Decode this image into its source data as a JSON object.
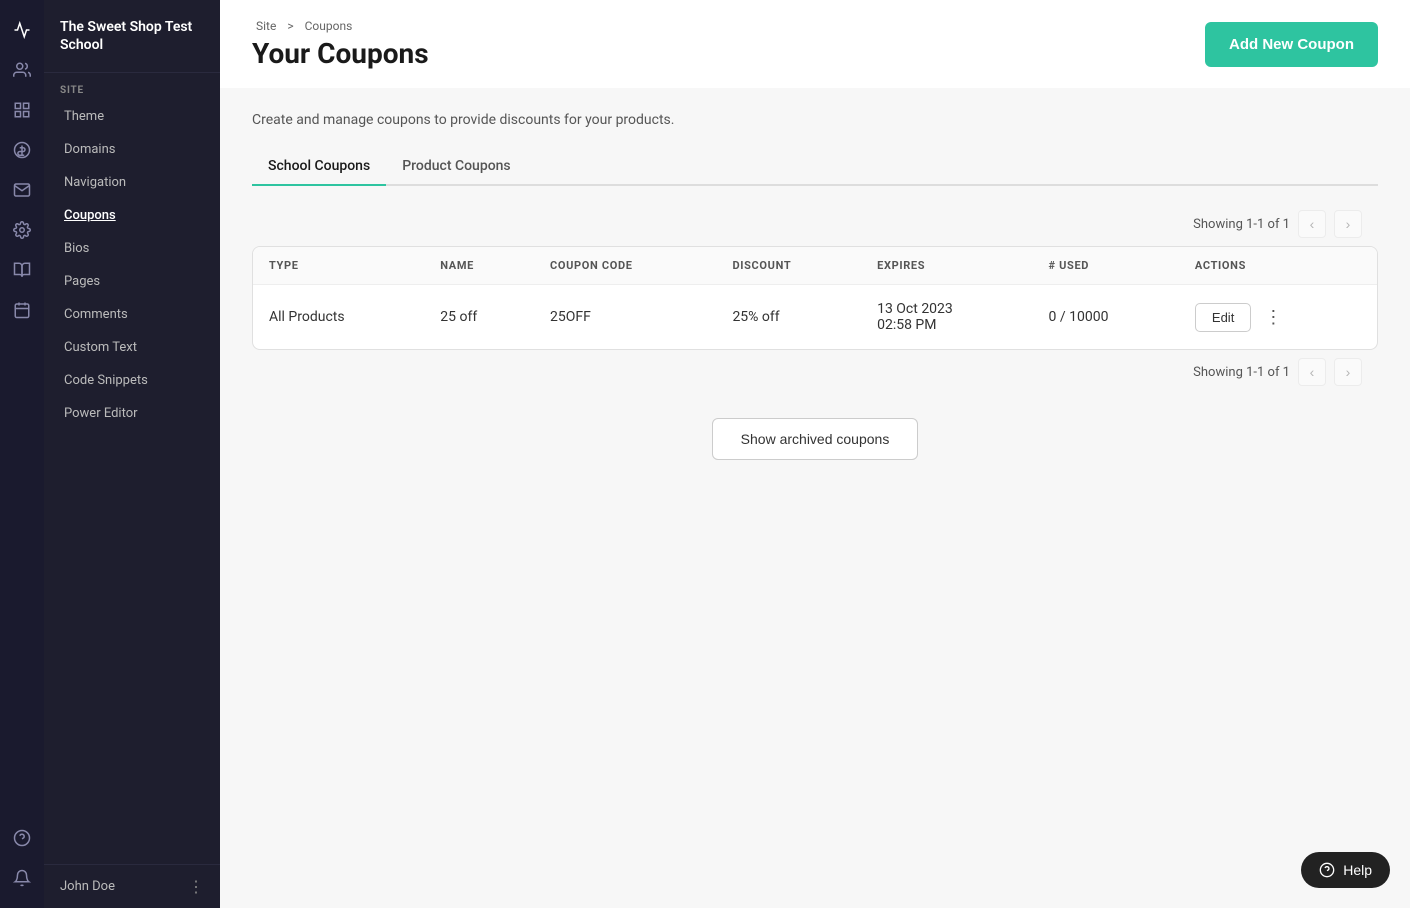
{
  "app": {
    "school_name": "The Sweet Shop Test School"
  },
  "icon_rail": {
    "icons": [
      {
        "name": "analytics-icon",
        "symbol": "📈"
      },
      {
        "name": "people-icon",
        "symbol": "👥"
      },
      {
        "name": "dashboard-icon",
        "symbol": "▦"
      },
      {
        "name": "dollar-icon",
        "symbol": "＄"
      },
      {
        "name": "mail-icon",
        "symbol": "✉"
      },
      {
        "name": "gear-icon",
        "symbol": "⚙"
      },
      {
        "name": "library-icon",
        "symbol": "≡"
      },
      {
        "name": "calendar-icon",
        "symbol": "▦"
      },
      {
        "name": "tag-icon",
        "symbol": "⊞"
      }
    ]
  },
  "sidebar": {
    "section_label": "SITE",
    "items": [
      {
        "label": "Theme",
        "active": false
      },
      {
        "label": "Domains",
        "active": false
      },
      {
        "label": "Navigation",
        "active": false
      },
      {
        "label": "Coupons",
        "active": true
      },
      {
        "label": "Bios",
        "active": false
      },
      {
        "label": "Pages",
        "active": false
      },
      {
        "label": "Comments",
        "active": false
      },
      {
        "label": "Custom Text",
        "active": false
      },
      {
        "label": "Code Snippets",
        "active": false
      },
      {
        "label": "Power Editor",
        "active": false
      }
    ],
    "footer_user": "John Doe"
  },
  "header": {
    "breadcrumb_site": "Site",
    "breadcrumb_sep": ">",
    "breadcrumb_page": "Coupons",
    "title": "Your Coupons",
    "subtitle": "Create and manage coupons to provide discounts for your products.",
    "add_button_label": "Add New Coupon"
  },
  "tabs": [
    {
      "label": "School Coupons",
      "active": true
    },
    {
      "label": "Product Coupons",
      "active": false
    }
  ],
  "pagination_top": {
    "showing": "Showing 1-1 of 1"
  },
  "pagination_bottom": {
    "showing": "Showing 1-1 of 1"
  },
  "table": {
    "columns": [
      "TYPE",
      "NAME",
      "COUPON CODE",
      "DISCOUNT",
      "EXPIRES",
      "# USED",
      "ACTIONS"
    ],
    "rows": [
      {
        "type": "All Products",
        "name": "25 off",
        "coupon_code": "25OFF",
        "discount": "25% off",
        "expires_line1": "13 Oct 2023",
        "expires_line2": "02:58 PM",
        "used": "0 / 10000",
        "edit_label": "Edit"
      }
    ]
  },
  "show_archived_label": "Show archived coupons",
  "help": {
    "label": "Help"
  }
}
